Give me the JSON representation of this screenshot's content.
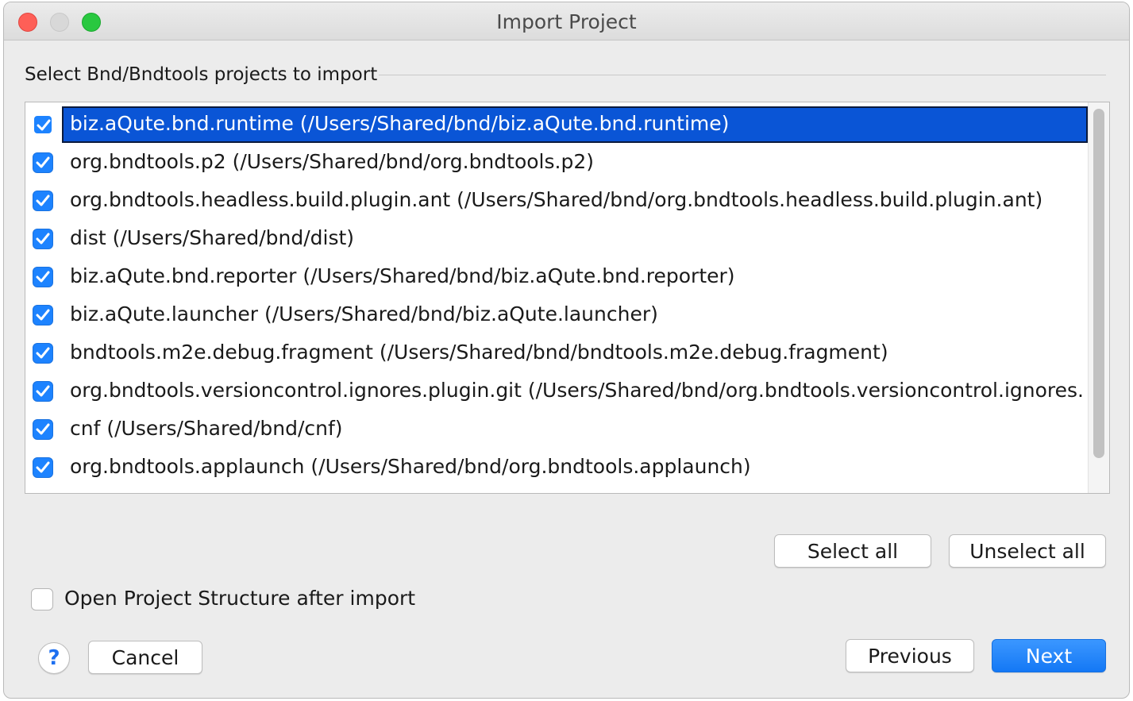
{
  "window": {
    "title": "Import Project"
  },
  "section": {
    "label": "Select Bnd/Bndtools projects to import"
  },
  "projects": [
    {
      "label": "biz.aQute.bnd.runtime (/Users/Shared/bnd/biz.aQute.bnd.runtime)",
      "checked": true,
      "selected": true
    },
    {
      "label": "org.bndtools.p2 (/Users/Shared/bnd/org.bndtools.p2)",
      "checked": true,
      "selected": false
    },
    {
      "label": "org.bndtools.headless.build.plugin.ant (/Users/Shared/bnd/org.bndtools.headless.build.plugin.ant)",
      "checked": true,
      "selected": false
    },
    {
      "label": "dist (/Users/Shared/bnd/dist)",
      "checked": true,
      "selected": false
    },
    {
      "label": "biz.aQute.bnd.reporter (/Users/Shared/bnd/biz.aQute.bnd.reporter)",
      "checked": true,
      "selected": false
    },
    {
      "label": "biz.aQute.launcher (/Users/Shared/bnd/biz.aQute.launcher)",
      "checked": true,
      "selected": false
    },
    {
      "label": "bndtools.m2e.debug.fragment (/Users/Shared/bnd/bndtools.m2e.debug.fragment)",
      "checked": true,
      "selected": false
    },
    {
      "label": "org.bndtools.versioncontrol.ignores.plugin.git (/Users/Shared/bnd/org.bndtools.versioncontrol.ignores.",
      "checked": true,
      "selected": false
    },
    {
      "label": "cnf (/Users/Shared/bnd/cnf)",
      "checked": true,
      "selected": false
    },
    {
      "label": "org.bndtools.applaunch (/Users/Shared/bnd/org.bndtools.applaunch)",
      "checked": true,
      "selected": false
    }
  ],
  "actions": {
    "select_all": "Select all",
    "unselect_all": "Unselect all"
  },
  "options": {
    "open_structure_label": "Open Project Structure after import",
    "open_structure_checked": false
  },
  "footer": {
    "help_glyph": "?",
    "cancel": "Cancel",
    "previous": "Previous",
    "next": "Next"
  },
  "colors": {
    "accent": "#1478f5",
    "selection": "#0a55d6"
  }
}
